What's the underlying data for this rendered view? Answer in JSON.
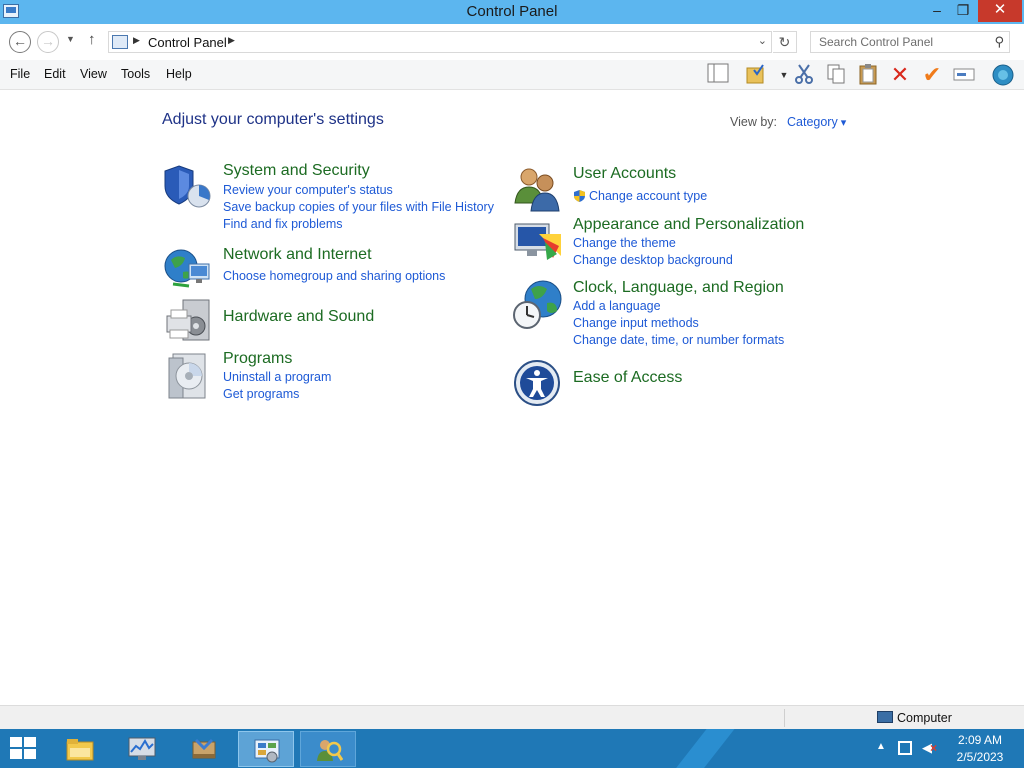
{
  "window": {
    "title": "Control Panel",
    "minimize": "–",
    "maximize": "❐",
    "close": "✕"
  },
  "address": {
    "back": "←",
    "forward": "→",
    "recent": "▼",
    "up": "↑",
    "sep": "▶",
    "crumb": "Control Panel",
    "dropdown": "⌄",
    "refresh": "↻",
    "search_placeholder": "Search Control Panel",
    "search_icon": "⚲"
  },
  "menu": [
    "File",
    "Edit",
    "View",
    "Tools",
    "Help"
  ],
  "toolbar_icons": [
    "layout-icon",
    "folder-options-icon",
    "cut-icon",
    "copy-icon",
    "paste-icon",
    "delete-icon",
    "checkmark-icon",
    "rename-icon",
    "shell-icon"
  ],
  "main": {
    "heading": "Adjust your computer's settings",
    "view_by_label": "View by:",
    "view_by_value": "Category",
    "left_categories": [
      {
        "title": "System and Security",
        "icon": "shield-icon",
        "links": [
          "Review your computer's status",
          "Save backup copies of your files with File History",
          "Find and fix problems"
        ]
      },
      {
        "title": "Network and Internet",
        "icon": "network-globe-icon",
        "links": [
          "Choose homegroup and sharing options"
        ]
      },
      {
        "title": "Hardware and Sound",
        "icon": "printer-icon",
        "links": []
      },
      {
        "title": "Programs",
        "icon": "programs-disc-icon",
        "links": [
          "Uninstall a program",
          "Get programs"
        ]
      }
    ],
    "right_categories": [
      {
        "title": "User Accounts",
        "icon": "users-icon",
        "links": [
          "Change account type"
        ]
      },
      {
        "title": "Appearance and Personalization",
        "icon": "monitor-palette-icon",
        "links": [
          "Change the theme",
          "Change desktop background"
        ]
      },
      {
        "title": "Clock, Language, and Region",
        "icon": "clock-globe-icon",
        "links": [
          "Add a language",
          "Change input methods",
          "Change date, time, or number formats"
        ]
      },
      {
        "title": "Ease of Access",
        "icon": "ease-of-access-icon",
        "links": []
      }
    ]
  },
  "status": {
    "label": "Computer"
  },
  "taskbar": {
    "apps": [
      "file-explorer-icon",
      "performance-monitor-icon",
      "server-manager-icon",
      "control-panel-icon",
      "user-search-icon"
    ],
    "tray_arrow": "▲",
    "volume": "◀",
    "time": "2:09 AM",
    "date": "2/5/2023"
  },
  "colors": {
    "title_bar": "#5cb6ef",
    "taskbar": "#1f78b6",
    "link": "#1e5ad6",
    "category_title": "#1c6b22",
    "heading": "#1e3287",
    "close_button": "#c7392b"
  }
}
